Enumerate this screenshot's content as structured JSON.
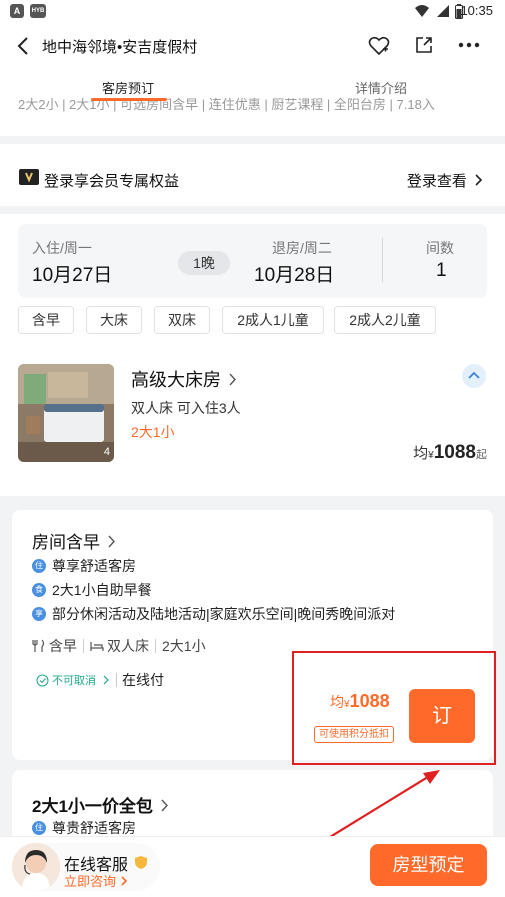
{
  "status_bar": {
    "badge_a": "A",
    "badge_b": "HYB",
    "time": "10:35"
  },
  "header": {
    "title": "地中海邻境•安吉度假村"
  },
  "tabs": [
    {
      "label": "客房预订",
      "active": true
    },
    {
      "label": "详情介绍",
      "active": false
    }
  ],
  "cut_strip_text": "2大2小 | 2大1小 | 可选房间含早 | 连住优惠 | 厨艺课程 | 全阳台房 | 7.18入",
  "member": {
    "text": "登录享会员专属权益",
    "link": "登录查看"
  },
  "dates": {
    "checkin_label": "入住/周一",
    "checkin_date": "10月27日",
    "nights": "1晚",
    "checkout_label": "退房/周二",
    "checkout_date": "10月28日",
    "rooms_label": "间数",
    "rooms_value": "1"
  },
  "filters": [
    "含早",
    "大床",
    "双床",
    "2成人1儿童",
    "2成人2儿童"
  ],
  "room": {
    "name": "高级大床房",
    "desc": "双人床  可入住3人",
    "occupancy": "2大1小",
    "image_count": "4",
    "price_prefix": "均",
    "currency": "¥",
    "price": "1088",
    "price_suffix": "起"
  },
  "plan": {
    "title": "房间含早",
    "items": [
      {
        "icon": "住",
        "text": "尊享舒适客房"
      },
      {
        "icon": "食",
        "text": "2大1小自助早餐"
      },
      {
        "icon": "享",
        "text": "部分休闲活动及陆地活动|家庭欢乐空间|晚间秀晚间派对"
      }
    ],
    "tags": [
      "含早",
      "双人床",
      "2大1小"
    ],
    "cancel": "不可取消",
    "pay": "在线付",
    "price_prefix": "均",
    "currency": "¥",
    "price": "1088",
    "points": "可使用积分抵扣",
    "book": "订"
  },
  "plan2": {
    "title": "2大1小一价全包",
    "item_icon": "住",
    "item_text": "尊贵舒适客房"
  },
  "bottom": {
    "cs_title": "在线客服",
    "cs_sub": "立即咨询",
    "book": "房型预定"
  },
  "colors": {
    "accent": "#ff6a2a",
    "blue": "#4a90e2",
    "annotation": "#e02020"
  }
}
